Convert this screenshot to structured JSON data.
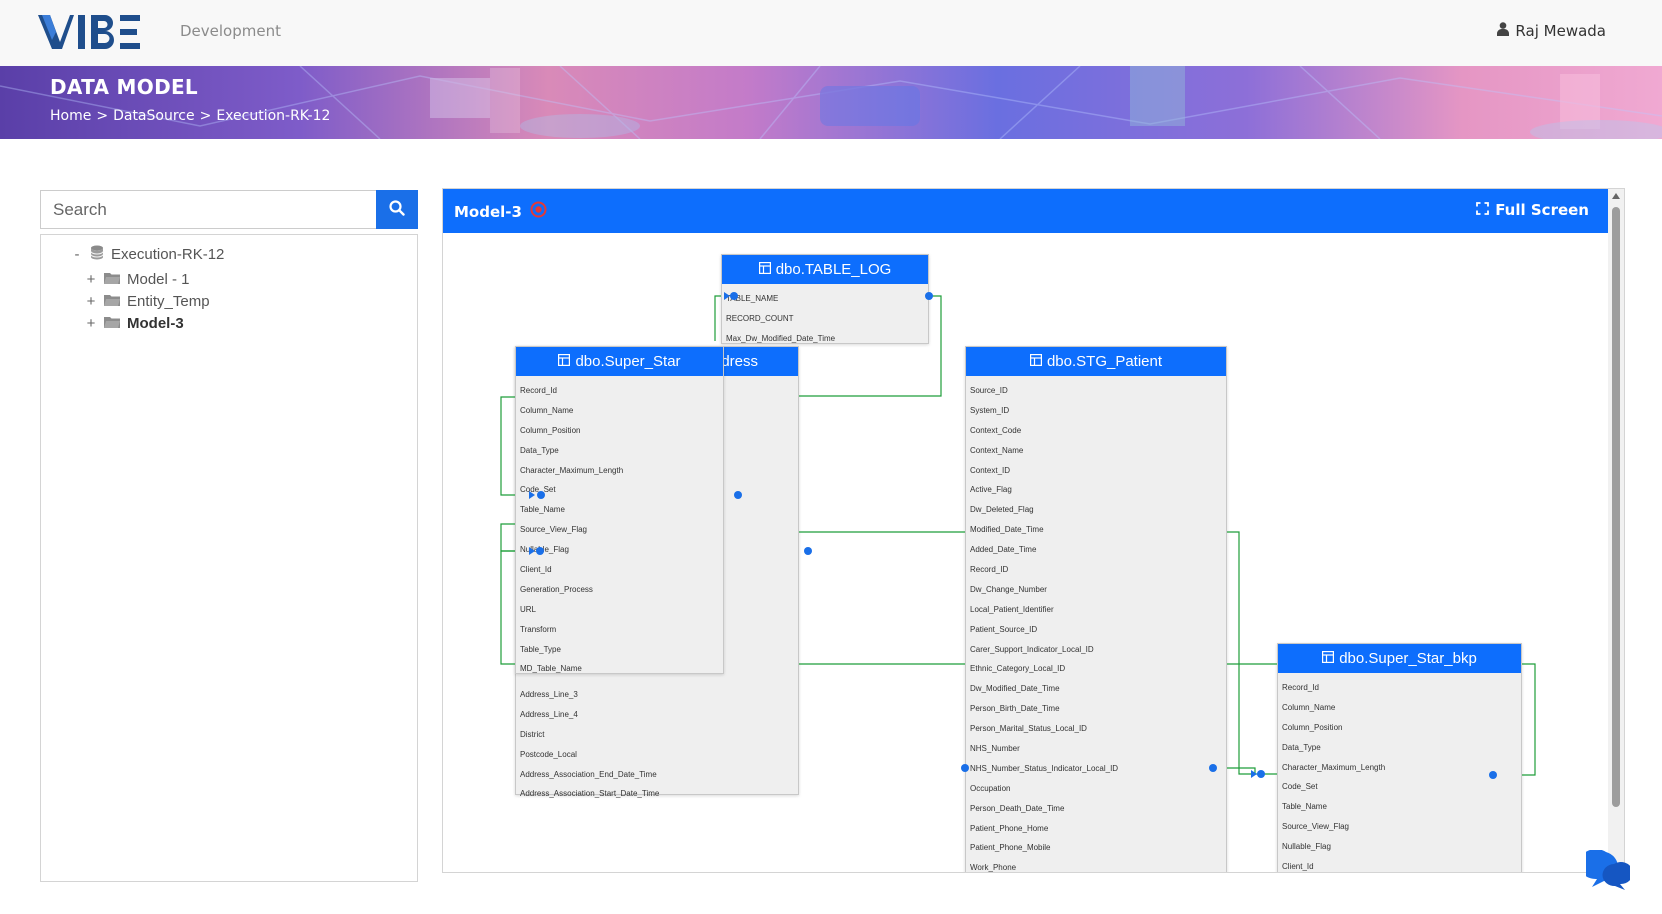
{
  "header": {
    "logo_text": "VIBE",
    "environment": "Development",
    "user_name": "Raj Mewada"
  },
  "banner": {
    "title": "DATA MODEL",
    "breadcrumb": [
      "Home",
      ">",
      "DataSource",
      ">",
      "Execution-RK-12"
    ]
  },
  "sidebar": {
    "search_placeholder": "Search",
    "tree": {
      "root": {
        "toggle": "-",
        "label": "Execution-RK-12"
      },
      "children": [
        {
          "toggle": "+",
          "label": "Model - 1",
          "selected": false
        },
        {
          "toggle": "+",
          "label": "Entity_Temp",
          "selected": false
        },
        {
          "toggle": "+",
          "label": "Model-3",
          "selected": true
        }
      ]
    }
  },
  "panel": {
    "model_title": "Model-3",
    "fullscreen_label": "Full Screen"
  },
  "entities": {
    "table_log": {
      "name": "dbo.TABLE_LOG",
      "attributes": [
        "TABLE_NAME",
        "RECORD_COUNT",
        "Max_Dw_Modified_Date_Time"
      ]
    },
    "address": {
      "name_visible": "dress",
      "attributes": [
        "Address_Line_3",
        "Address_Line_4",
        "District",
        "Postcode_Local",
        "Address_Association_End_Date_Time",
        "Address_Association_Start_Date_Time"
      ]
    },
    "super_star": {
      "name": "dbo.Super_Star",
      "attributes": [
        "Record_Id",
        "Column_Name",
        "Column_Position",
        "Data_Type",
        "Character_Maximum_Length",
        "Code_Set",
        "Table_Name",
        "Source_View_Flag",
        "Nullable_Flag",
        "Client_Id",
        "Generation_Process",
        "URL",
        "Transform",
        "Table_Type",
        "MD_Table_Name"
      ]
    },
    "stg_patient": {
      "name": "dbo.STG_Patient",
      "attributes": [
        "Source_ID",
        "System_ID",
        "Context_Code",
        "Context_Name",
        "Context_ID",
        "Active_Flag",
        "Dw_Deleted_Flag",
        "Modified_Date_Time",
        "Added_Date_Time",
        "Record_ID",
        "Dw_Change_Number",
        "Local_Patient_Identifier",
        "Patient_Source_ID",
        "Carer_Support_Indicator_Local_ID",
        "Ethnic_Category_Local_ID",
        "Dw_Modified_Date_Time",
        "Person_Birth_Date_Time",
        "Person_Marital_Status_Local_ID",
        "NHS_Number",
        "NHS_Number_Status_Indicator_Local_ID",
        "Occupation",
        "Person_Death_Date_Time",
        "Patient_Phone_Home",
        "Patient_Phone_Mobile",
        "Work_Phone"
      ]
    },
    "super_star_bkp": {
      "name": "dbo.Super_Star_bkp",
      "attributes": [
        "Record_Id",
        "Column_Name",
        "Column_Position",
        "Data_Type",
        "Character_Maximum_Length",
        "Code_Set",
        "Table_Name",
        "Source_View_Flag",
        "Nullable_Flag",
        "Client_Id"
      ]
    }
  },
  "colors": {
    "primary": "#0d6efd",
    "link_line": "#1e9e3a",
    "connector_dot": "#1a6fe8",
    "target_icon": "#e53935"
  }
}
